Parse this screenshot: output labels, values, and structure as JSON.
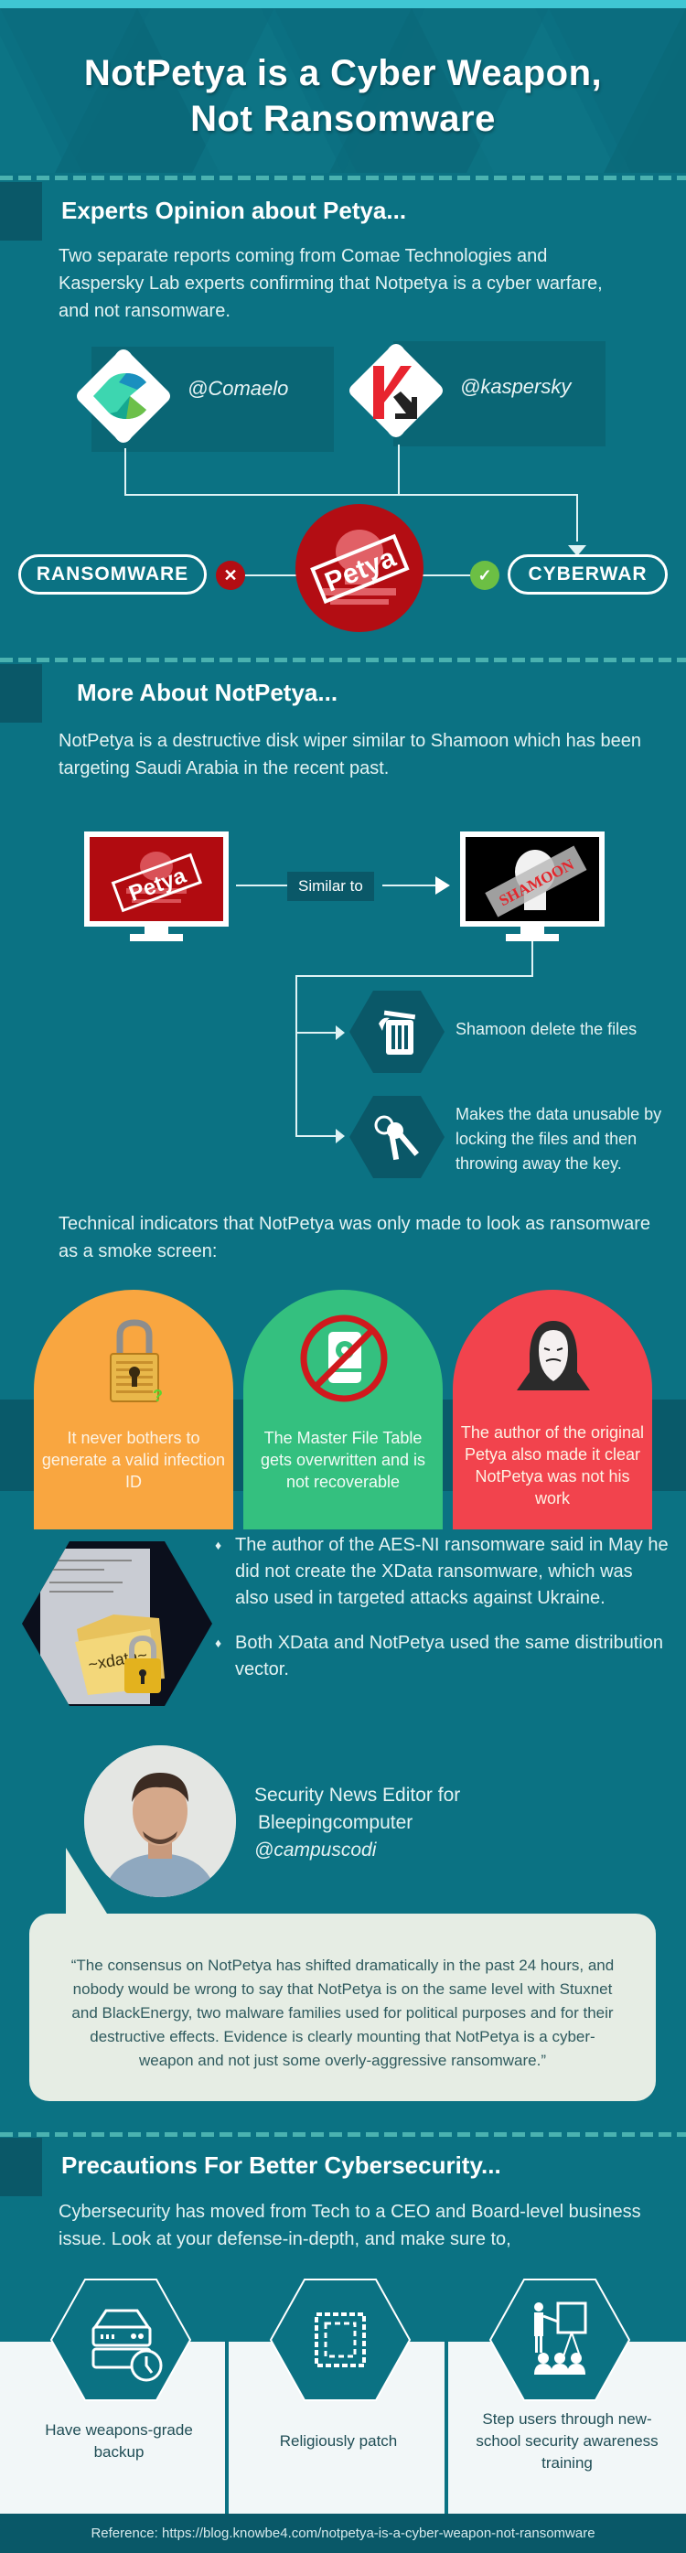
{
  "header": {
    "title_line1": "NotPetya is a Cyber Weapon,",
    "title_line2": "Not Ransomware"
  },
  "experts": {
    "title": "Experts Opinion about Petya...",
    "body": "Two separate reports coming from Comae Technologies and Kaspersky Lab experts confirming that Notpetya is a cyber warfare, and not ransomware.",
    "sources": [
      {
        "handle": "@Comaelo",
        "icon": "comae-logo-icon"
      },
      {
        "handle": "@kaspersky",
        "icon": "kaspersky-logo-icon"
      }
    ],
    "left_label": "RANSOMWARE",
    "left_status": "✕",
    "center_label": "Petya",
    "right_label": "CYBERWAR",
    "right_status": "✓",
    "colors": {
      "wrong": "#b30d13",
      "right": "#6cbf44"
    }
  },
  "more": {
    "title": "More About NotPetya...",
    "body": "NotPetya is a destructive disk wiper similar to Shamoon which has been targeting Saudi Arabia in the recent past.",
    "left_screen_label": "Petya",
    "similar_label": "Similar to",
    "right_screen_label": "SHAMOON",
    "features": [
      {
        "icon": "trash-icon",
        "text": "Shamoon delete the files"
      },
      {
        "icon": "keys-icon",
        "text": "Makes the data unusable by locking the files and then throwing away the key."
      }
    ],
    "indicators_intro": "Technical indicators that NotPetya was only made to look as ransomware as a smoke screen:",
    "indicators": [
      {
        "icon": "padlock-question-icon",
        "text": "It never bothers to generate a valid infection ID",
        "color": "#f9a640"
      },
      {
        "icon": "no-disk-icon",
        "text": "The Master File Table gets overwritten and is not recoverable",
        "color": "#34c07f"
      },
      {
        "icon": "anonymous-hacker-icon",
        "text": "The author of the original Petya also made it clear NotPetya was not his work",
        "color": "#f2434d"
      }
    ],
    "xdata_label": "~xdata~",
    "bullets": [
      "The author of the AES-NI ransomware said in May he did not create the XData ransomware, which was also used in targeted attacks against Ukraine.",
      "Both XData and NotPetya used the same distribution vector."
    ],
    "bullet_glyph": "♦"
  },
  "quote": {
    "role_line1": "Security News Editor for",
    "role_line2": "Bleepingcomputer",
    "handle": "@campuscodi",
    "text": "“The consensus on NotPetya has shifted dramatically in the past 24 hours, and nobody would be wrong to say that NotPetya is on the same level with Stuxnet and BlackEnergy, two malware families used for political purposes and for their destructive effects. Evidence is clearly mounting that NotPetya is a cyber-weapon and not just some overly-aggressive ransomware.”"
  },
  "precautions": {
    "title": "Precautions For Better Cybersecurity...",
    "body": "Cybersecurity has moved from Tech to a CEO and Board-level business issue. Look at your defense-in-depth, and make sure to,",
    "items": [
      {
        "icon": "server-backup-icon",
        "text": "Have weapons-grade backup"
      },
      {
        "icon": "patch-icon",
        "text": "Religiously patch"
      },
      {
        "icon": "training-presentation-icon",
        "text": "Step users through new-school security awareness training"
      }
    ]
  },
  "footer": {
    "reference": "Reference: https://blog.knowbe4.com/notpetya-is-a-cyber-weapon-not-ransomware"
  }
}
